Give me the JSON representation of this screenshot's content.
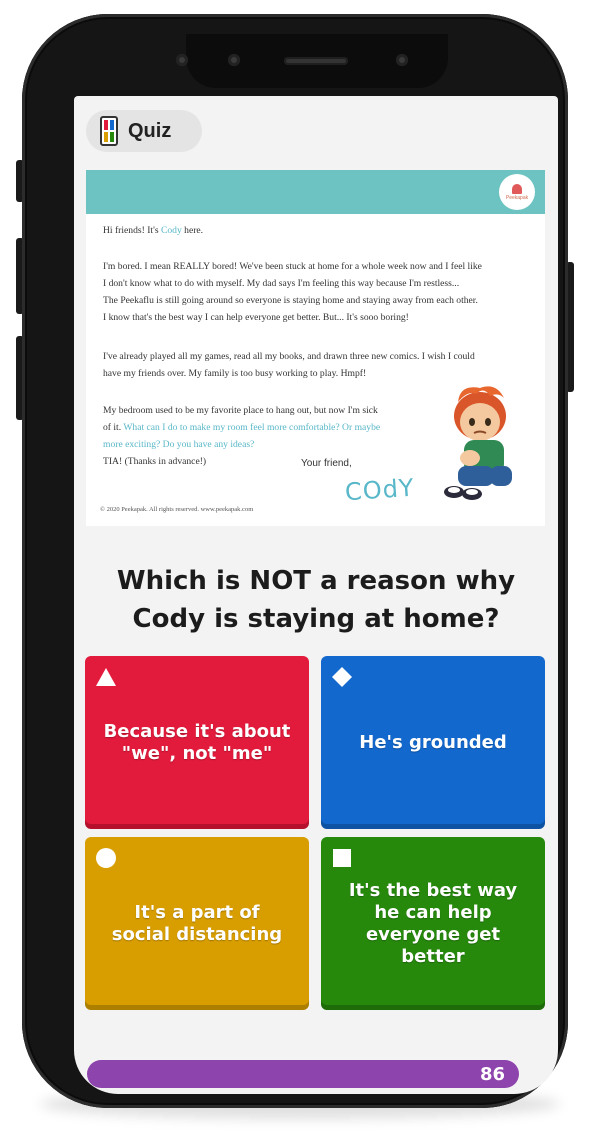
{
  "header": {
    "title": "Quiz",
    "icon": "quiz-grid-icon"
  },
  "letter": {
    "logo_text": "Peekapak",
    "greeting_prefix": "Hi friends! It's ",
    "greeting_name": "Cody",
    "greeting_suffix": " here.",
    "p1_l1": "I'm bored. I mean REALLY bored! We've been stuck at home for a whole week now and I feel like",
    "p1_l2": "I don't know what to do with myself. My dad says I'm feeling this way because I'm restless...",
    "p1_l3": "The Peekaflu is still going around so everyone is staying home and staying away from each other.",
    "p1_l4": "I know that's the best way I can help everyone get better. But...  It's sooo boring!",
    "p2_l1": "I've already played all my games, read all my  books, and drawn three new comics. I wish I could",
    "p2_l2": "have my friends over. My family is too busy working to play. Hmpf!",
    "p3_l1": "My bedroom used to be my favorite place to hang out, but now I'm sick",
    "p3_l2_prefix": "of it. ",
    "p3_l2_highlight": "What can I do to make my room feel more comfortable? Or maybe",
    "p3_l3": "more exciting? Do you have any ideas?",
    "p3_l4": "TIA! (Thanks in advance!)",
    "signoff": "Your friend,",
    "signature": "COdY",
    "copyright": "© 2020 Peekapak. All rights reserved. www.peekapak.com"
  },
  "question": {
    "line1": "Which is NOT a reason why",
    "line2": "Cody is staying at home?"
  },
  "answers": [
    {
      "shape": "triangle-icon",
      "text": "Because it's about \"we\", not \"me\"",
      "color": "#e21b3c"
    },
    {
      "shape": "diamond-icon",
      "text": "He's grounded",
      "color": "#1368ce"
    },
    {
      "shape": "circle-icon",
      "text": "It's a part of social distancing",
      "color": "#d89e00"
    },
    {
      "shape": "square-icon",
      "text": "It's the best way he can help everyone get better",
      "color": "#26890c"
    }
  ],
  "progress": {
    "value": "86",
    "color": "#8e44ad"
  }
}
